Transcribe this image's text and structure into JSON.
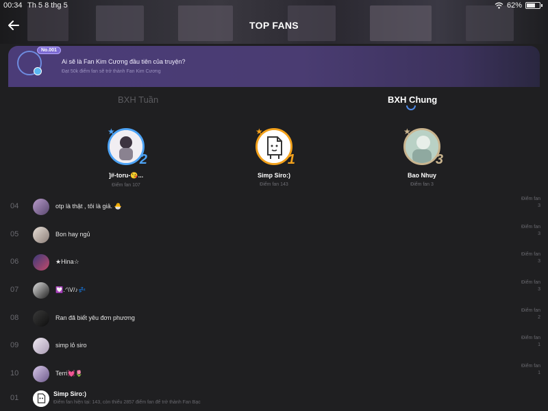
{
  "status": {
    "time": "00:34",
    "date": "Th 5 8 thg 5",
    "battery": "62%"
  },
  "header": {
    "title": "TOP FANS"
  },
  "promo": {
    "badge": "No.001",
    "question": "Ai sẽ là Fan Kim Cương đầu tiên của truyện?",
    "subtitle": "Đạt 50k điểm fan sẽ trở thành Fan Kim Cương"
  },
  "tabs": [
    {
      "label": "BXH Tuần",
      "active": false
    },
    {
      "label": "BXH Chung",
      "active": true
    }
  ],
  "podium": [
    {
      "rank": "2",
      "name": "]#-toru-😘...",
      "points": "Điểm fan 107",
      "color": "#4da3f5"
    },
    {
      "rank": "1",
      "name": "Simp Siro:)",
      "points": "Điểm fan 143",
      "color": "#f3a11b"
    },
    {
      "rank": "3",
      "name": "Bao Nhuy",
      "points": "Điểm fan 3",
      "color": "#c9b48e"
    }
  ],
  "list": [
    {
      "rank": "04",
      "name": "otp là thật , tôi là giả. 🐣",
      "label": "Điểm fan",
      "points": "3"
    },
    {
      "rank": "05",
      "name": "Bon hay ngủ",
      "label": "Điểm fan",
      "points": "3"
    },
    {
      "rank": "06",
      "name": "★Hina☆",
      "label": "Điểm fan",
      "points": "3"
    },
    {
      "rank": "07",
      "name": "💟.ᐟ\\V/♪💤",
      "label": "Điểm fan",
      "points": "3"
    },
    {
      "rank": "08",
      "name": "Ran đã biết yêu đơn phương",
      "label": "Điểm fan",
      "points": "2"
    },
    {
      "rank": "09",
      "name": "simp lỏ siro",
      "label": "Điểm fan",
      "points": "1"
    },
    {
      "rank": "10",
      "name": "Terri💓🌷",
      "label": "Điểm fan",
      "points": "1"
    }
  ],
  "me": {
    "rank": "01",
    "name": "Simp Siro:)",
    "sub": "Điểm fan hiện tại: 143, còn thiếu 2857 điểm fan để trở thành Fan Bạc"
  },
  "icons": {
    "back": "arrow-left-icon",
    "wifi": "wifi-icon",
    "battery": "battery-icon",
    "gem": "diamond-icon"
  }
}
